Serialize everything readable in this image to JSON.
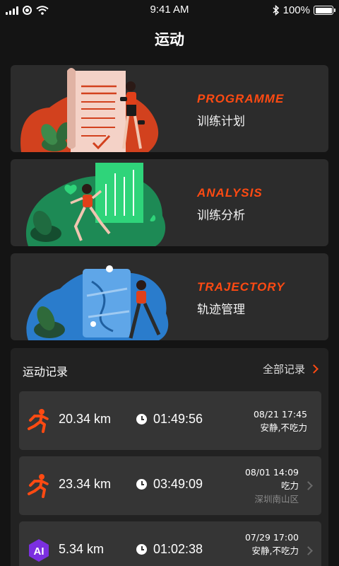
{
  "status_bar": {
    "time": "9:41 AM",
    "battery": "100%"
  },
  "page_title": "运动",
  "feature_cards": [
    {
      "title_en": "PROGRAMME",
      "title_zh": "训练计划"
    },
    {
      "title_en": "ANALYSIS",
      "title_zh": "训练分析"
    },
    {
      "title_en": "TRAJECTORY",
      "title_zh": "轨迹管理"
    }
  ],
  "records": {
    "title": "运动记录",
    "view_all": "全部记录",
    "items": [
      {
        "icon": "running-icon",
        "distance": "20.34 km",
        "duration": "01:49:56",
        "datetime": "08/21 17:45",
        "status": "安静,不吃力",
        "location": ""
      },
      {
        "icon": "running-icon",
        "distance": "23.34 km",
        "duration": "03:49:09",
        "datetime": "08/01 14:09",
        "status": "吃力",
        "location": "深圳南山区"
      },
      {
        "icon": "ai-badge",
        "badge_text": "AI",
        "distance": "5.34 km",
        "duration": "01:02:38",
        "datetime": "07/29 17:00",
        "status": "安静,不吃力",
        "location": ""
      }
    ]
  },
  "colors": {
    "accent": "#ff4a12",
    "background": "#141414",
    "card": "#2c2c2c",
    "ai_badge": "#7b2fe0"
  }
}
